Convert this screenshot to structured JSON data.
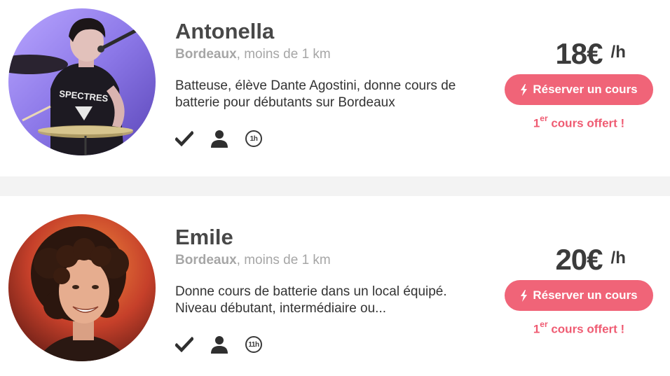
{
  "colors": {
    "accent": "#f06478",
    "offer_text": "#ef5b72",
    "separator": "#f3f3f3",
    "muted_text": "#a6a6a6"
  },
  "teachers": [
    {
      "name": "Antonella",
      "city": "Bordeaux",
      "distance": ", moins de 1 km",
      "description": "Batteuse, élève Dante Agostini, donne cours de batterie pour débutants sur Bordeaux",
      "icons": [
        "checkmark-icon",
        "person-icon",
        "duration-icon"
      ],
      "duration": "1h",
      "price": "18€",
      "per_unit": "/h",
      "book_label": "Réserver un cours",
      "offer_prefix": "1",
      "offer_sup": "er",
      "offer_rest": " cours offert !"
    },
    {
      "name": "Emile",
      "city": "Bordeaux",
      "distance": ", moins de 1 km",
      "description": "Donne cours de batterie dans un local équipé. Niveau débutant, intermédiaire ou...",
      "icons": [
        "checkmark-icon",
        "person-icon",
        "duration-icon"
      ],
      "duration": "11h",
      "price": "20€",
      "per_unit": "/h",
      "book_label": "Réserver un cours",
      "offer_prefix": "1",
      "offer_sup": "er",
      "offer_rest": " cours offert !"
    }
  ]
}
